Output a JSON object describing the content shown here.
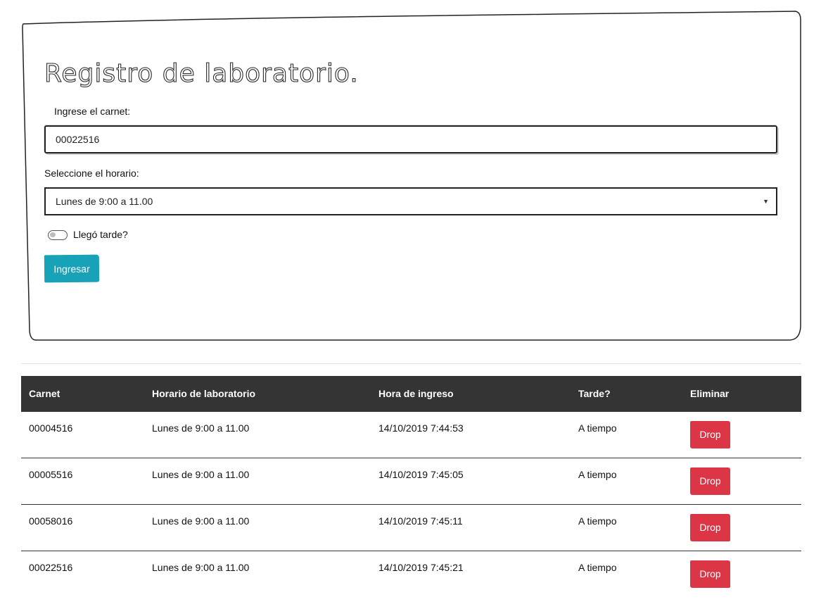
{
  "form": {
    "title": "Registro de laboratorio.",
    "carnet_label": "Ingrese el carnet:",
    "carnet_value": "00022516",
    "horario_label": "Seleccione el horario:",
    "horario_selected": "Lunes de 9:00 a 11.00",
    "tarde_label": "Llegó tarde?",
    "tarde_checked": false,
    "submit_label": "Ingresar"
  },
  "table": {
    "headers": [
      "Carnet",
      "Horario de laboratorio",
      "Hora de ingreso",
      "Tarde?",
      "Eliminar"
    ],
    "rows": [
      {
        "carnet": "00004516",
        "horario": "Lunes de 9:00 a 11.00",
        "hora": "14/10/2019 7:44:53",
        "tarde": "A tiempo",
        "action": "Drop"
      },
      {
        "carnet": "00005516",
        "horario": "Lunes de 9:00 a 11.00",
        "hora": "14/10/2019 7:45:05",
        "tarde": "A tiempo",
        "action": "Drop"
      },
      {
        "carnet": "00058016",
        "horario": "Lunes de 9:00 a 11.00",
        "hora": "14/10/2019 7:45:11",
        "tarde": "A tiempo",
        "action": "Drop"
      },
      {
        "carnet": "00022516",
        "horario": "Lunes de 9:00 a 11.00",
        "hora": "14/10/2019 7:45:21",
        "tarde": "A tiempo",
        "action": "Drop"
      }
    ]
  },
  "colors": {
    "primary_button": "#17a2b8",
    "danger_button": "#dc3545",
    "table_header_bg": "#343434"
  }
}
